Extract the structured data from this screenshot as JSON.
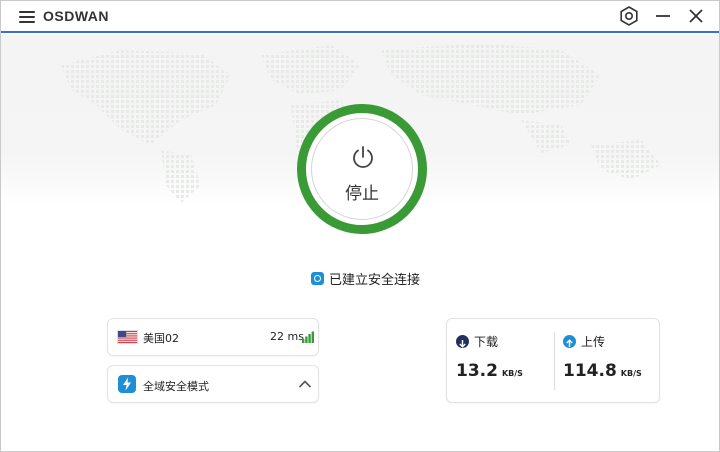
{
  "app": {
    "title": "OSDWAN"
  },
  "titlebar": {
    "icons": [
      "menu-icon",
      "settings-icon",
      "minimize-icon",
      "close-icon"
    ]
  },
  "power": {
    "label": "停止",
    "ring_color": "#3a9a36"
  },
  "status": {
    "text": "已建立安全连接",
    "icon": "shield-icon",
    "icon_color": "#1e8fd6"
  },
  "server": {
    "name": "美国02",
    "ping": "22 ms",
    "flag": "us-flag-icon",
    "signal_color": "#3a9a36"
  },
  "mode": {
    "label": "全域安全模式",
    "icon": "lightning-icon"
  },
  "speed": {
    "download": {
      "label": "下载",
      "value": "13.2",
      "unit": "KB/S",
      "badge_color": "#232f5c"
    },
    "upload": {
      "label": "上传",
      "value": "114.8",
      "unit": "KB/S",
      "badge_color": "#1e8fd6"
    }
  }
}
